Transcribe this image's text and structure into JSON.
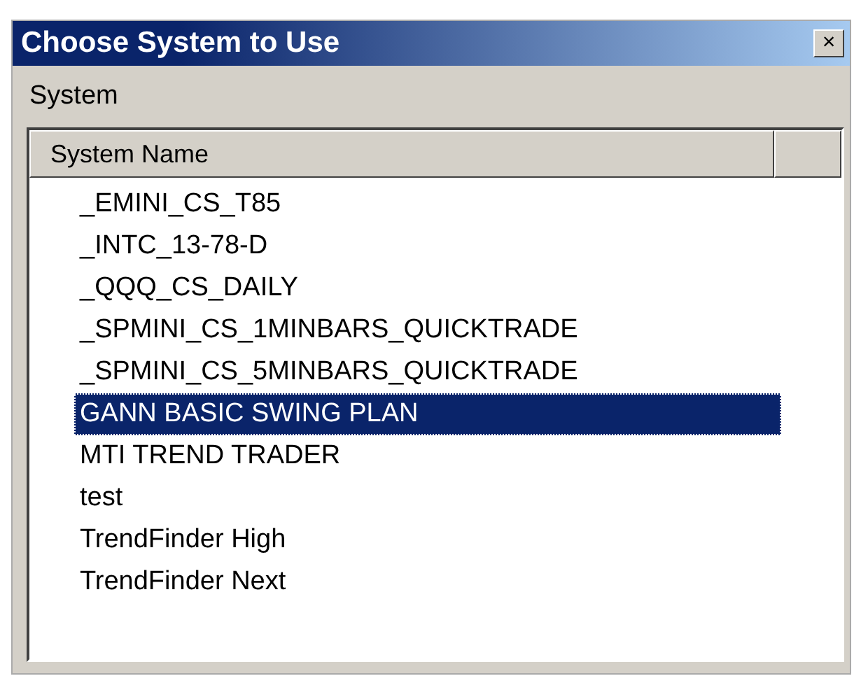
{
  "window": {
    "title": "Choose System to Use",
    "close": "×"
  },
  "menu": [
    "System"
  ],
  "list": {
    "columns": [
      "System Name"
    ],
    "rows": [
      {
        "name": "_EMINI_CS_T85",
        "selected": false
      },
      {
        "name": "_INTC_13-78-D",
        "selected": false
      },
      {
        "name": "_QQQ_CS_DAILY",
        "selected": false
      },
      {
        "name": "_SPMINI_CS_1MINBARS_QUICKTRADE",
        "selected": false
      },
      {
        "name": "_SPMINI_CS_5MINBARS_QUICKTRADE",
        "selected": false
      },
      {
        "name": "GANN BASIC SWING PLAN",
        "selected": true
      },
      {
        "name": "MTI TREND TRADER",
        "selected": false
      },
      {
        "name": "test",
        "selected": false
      },
      {
        "name": "TrendFinder High",
        "selected": false
      },
      {
        "name": "TrendFinder Next",
        "selected": false
      }
    ]
  }
}
